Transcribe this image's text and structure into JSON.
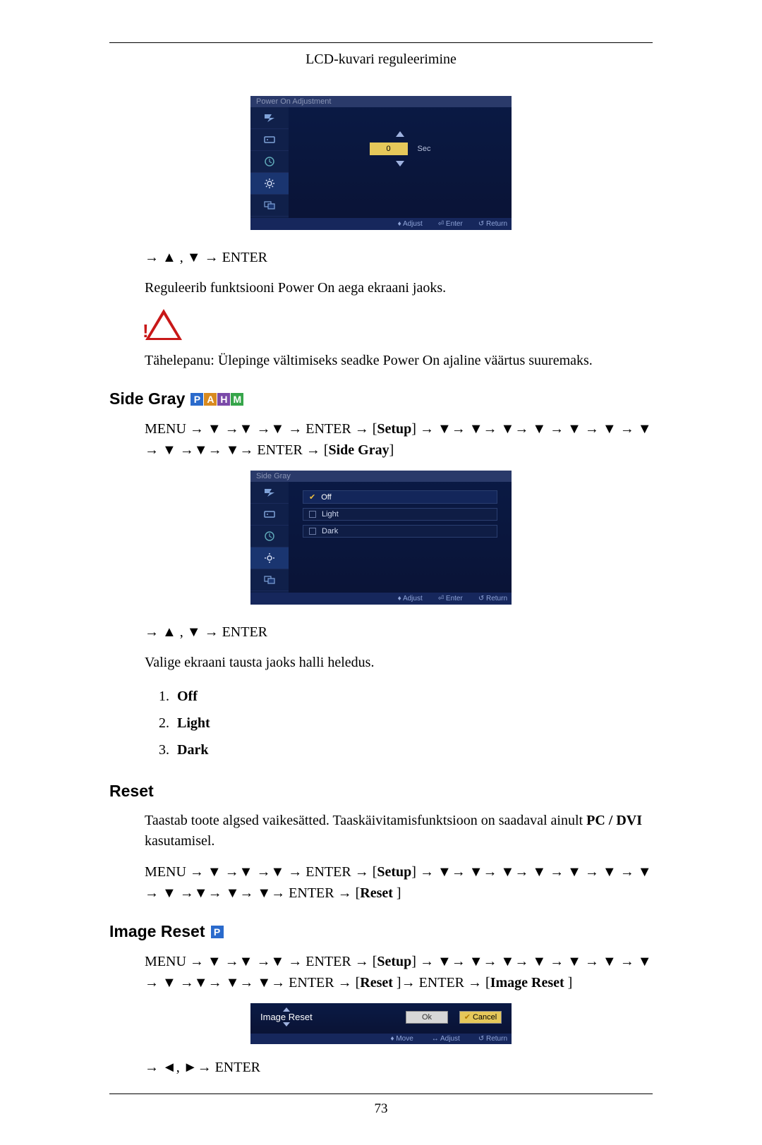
{
  "header": {
    "title": "LCD-kuvari reguleerimine"
  },
  "footer": {
    "page": "73"
  },
  "osd_power": {
    "title": "Power On Adjustment",
    "value": "0",
    "unit": "Sec",
    "footer": {
      "adjust": "Adjust",
      "enter": "Enter",
      "return": "Return"
    }
  },
  "nav1": {
    "text": "→ ▲ , ▼ → ENTER"
  },
  "para1": "Reguleerib funktsiooni Power On aega ekraani jaoks.",
  "para2": "Tähelepanu: Ülepinge vältimiseks seadke Power On ajaline väärtus suuremaks.",
  "section_sidegray": {
    "title": "Side Gray"
  },
  "nav_sidegray_pre": "MENU → ▼ →▼ →▼ → ENTER → [",
  "nav_sidegray_setup": "Setup",
  "nav_sidegray_mid": "] → ▼→ ▼→ ▼→ ▼ → ▼ → ▼ → ▼ → ▼ →▼→ ▼→ ENTER → [",
  "nav_sidegray_target": "Side Gray",
  "nav_sidegray_post": "]",
  "osd_sidegray": {
    "title": "Side Gray",
    "options": [
      "Off",
      "Light",
      "Dark"
    ],
    "footer": {
      "adjust": "Adjust",
      "enter": "Enter",
      "return": "Return"
    }
  },
  "nav2": {
    "text": "→ ▲ , ▼ → ENTER"
  },
  "para3": "Valige ekraani tausta jaoks halli heledus.",
  "list": {
    "i1": "Off",
    "i2": "Light",
    "i3": "Dark"
  },
  "section_reset": {
    "title": "Reset"
  },
  "para4_pre": "Taastab toote algsed vaikesätted. Taaskäivitamisfunktsioon on saadaval ainult ",
  "para4_bold": "PC / DVI",
  "para4_post": " kasutamisel.",
  "nav_reset_pre": "MENU → ▼ →▼ →▼ → ENTER → [",
  "nav_reset_setup": "Setup",
  "nav_reset_mid": "] → ▼→ ▼→ ▼→ ▼ → ▼ → ▼ → ▼ → ▼ →▼→ ▼→ ▼→ ENTER → [",
  "nav_reset_target": "Reset ",
  "nav_reset_post": "]",
  "section_imagereset": {
    "title": "Image Reset"
  },
  "nav_ir_pre": "MENU → ▼ →▼ →▼ → ENTER → [",
  "nav_ir_setup": "Setup",
  "nav_ir_mid": "] → ▼→ ▼→ ▼→ ▼ → ▼ → ▼ → ▼ → ▼ →▼→ ▼→ ▼→ ENTER → [",
  "nav_ir_reset": "Reset ",
  "nav_ir_mid2": "]→ ENTER → [",
  "nav_ir_target": "Image Reset ",
  "nav_ir_post": "]",
  "osd_ir": {
    "label": "Image Reset",
    "ok": "Ok",
    "cancel": "Cancel",
    "footer": {
      "move": "Move",
      "adjust": "Adjust",
      "return": "Return"
    }
  },
  "nav3": {
    "text": "→ ◄, ►→ ENTER"
  }
}
